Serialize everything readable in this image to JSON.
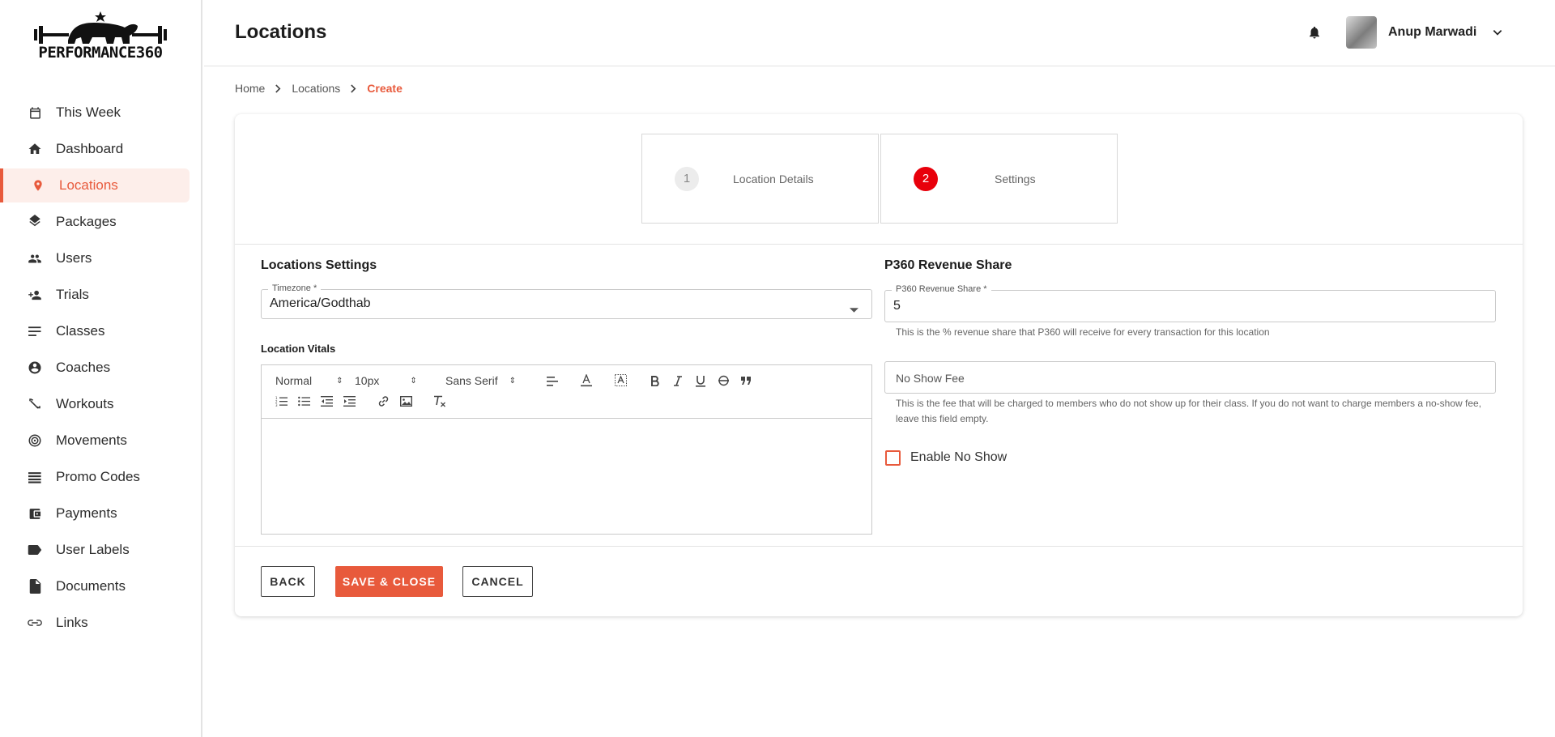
{
  "brand": {
    "logo_text": "PERFORMANCE360",
    "accent": "#e85a3c",
    "step_active": "#e8000b"
  },
  "sidebar": {
    "items": [
      {
        "label": "This Week",
        "icon": "calendar-icon"
      },
      {
        "label": "Dashboard",
        "icon": "home-icon"
      },
      {
        "label": "Locations",
        "icon": "location-pin-icon",
        "active": true
      },
      {
        "label": "Packages",
        "icon": "layers-icon"
      },
      {
        "label": "Users",
        "icon": "users-icon"
      },
      {
        "label": "Trials",
        "icon": "person-add-icon"
      },
      {
        "label": "Classes",
        "icon": "lines-icon"
      },
      {
        "label": "Coaches",
        "icon": "account-circle-icon"
      },
      {
        "label": "Workouts",
        "icon": "fitness-icon"
      },
      {
        "label": "Movements",
        "icon": "target-icon"
      },
      {
        "label": "Promo Codes",
        "icon": "list-stack-icon"
      },
      {
        "label": "Payments",
        "icon": "wallet-icon"
      },
      {
        "label": "User Labels",
        "icon": "label-icon"
      },
      {
        "label": "Documents",
        "icon": "document-icon"
      },
      {
        "label": "Links",
        "icon": "link-icon"
      }
    ]
  },
  "header": {
    "title": "Locations",
    "user_name": "Anup Marwadi"
  },
  "breadcrumb": {
    "home": "Home",
    "locations": "Locations",
    "current": "Create"
  },
  "stepper": {
    "steps": [
      {
        "number": "1",
        "label": "Location Details",
        "state": "inactive"
      },
      {
        "number": "2",
        "label": "Settings",
        "state": "active"
      }
    ]
  },
  "left": {
    "title": "Locations Settings",
    "timezone": {
      "label": "Timezone *",
      "value": "America/Godthab"
    },
    "vitals_title": "Location Vitals",
    "toolbar": {
      "format": "Normal",
      "size": "10px",
      "font": "Sans Serif"
    }
  },
  "right": {
    "title": "P360 Revenue Share",
    "revenue": {
      "label": "P360 Revenue Share *",
      "value": "5",
      "helper": "This is the % revenue share that P360 will receive for every transaction for this location"
    },
    "no_show": {
      "placeholder": "No Show Fee",
      "helper_line1": "This is the fee that will be charged to members who do not show up for their class. If you do not want to charge members a no-show fee,",
      "helper_line2": "leave this field empty."
    },
    "enable_no_show": {
      "label": "Enable No Show",
      "checked": false
    }
  },
  "actions": {
    "back": "BACK",
    "save": "SAVE & CLOSE",
    "cancel": "CANCEL"
  }
}
